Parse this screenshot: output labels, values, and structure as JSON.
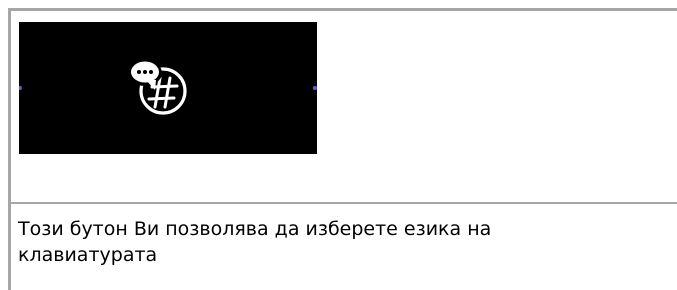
{
  "image": {
    "icon": "speech-bubble-globe-icon",
    "background_color": "#000000",
    "icon_color": "#ffffff",
    "accent_color": "#6a5acd"
  },
  "caption": "Този бутон Ви позволява да изберете езика на клавиатурата",
  "border_color": "#a6a6a6"
}
